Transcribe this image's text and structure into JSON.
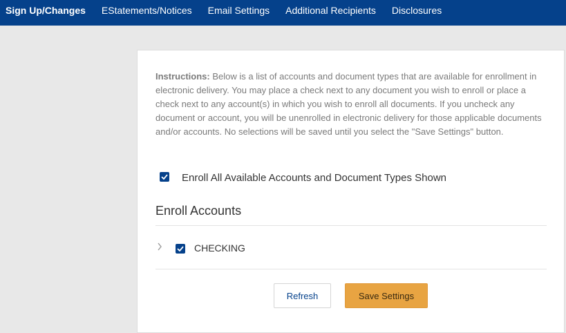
{
  "nav": {
    "tabs": [
      {
        "label": "Sign Up/Changes",
        "active": true
      },
      {
        "label": "EStatements/Notices",
        "active": false
      },
      {
        "label": "Email Settings",
        "active": false
      },
      {
        "label": "Additional Recipients",
        "active": false
      },
      {
        "label": "Disclosures",
        "active": false
      }
    ],
    "bar_color": "#05418b"
  },
  "instructions": {
    "label": "Instructions:",
    "text": " Below is a list of accounts and document types that are available for enrollment in electronic delivery. You may place a check next to any document you wish to enroll or place a check next to any account(s) in which you wish to enroll all documents. If you uncheck any document or account, you will be unenrolled in electronic delivery for those applicable documents and/or accounts. No selections will be saved until you select the \"Save Settings\" button."
  },
  "enroll_all": {
    "label": "Enroll All Available Accounts and Document Types Shown",
    "checked": true
  },
  "enroll_accounts": {
    "title": "Enroll Accounts",
    "accounts": [
      {
        "name": "CHECKING",
        "checked": true,
        "expand_icon": "chevron-right-icon"
      }
    ]
  },
  "actions": {
    "refresh_label": "Refresh",
    "save_label": "Save Settings",
    "save_color": "#e8a442"
  }
}
